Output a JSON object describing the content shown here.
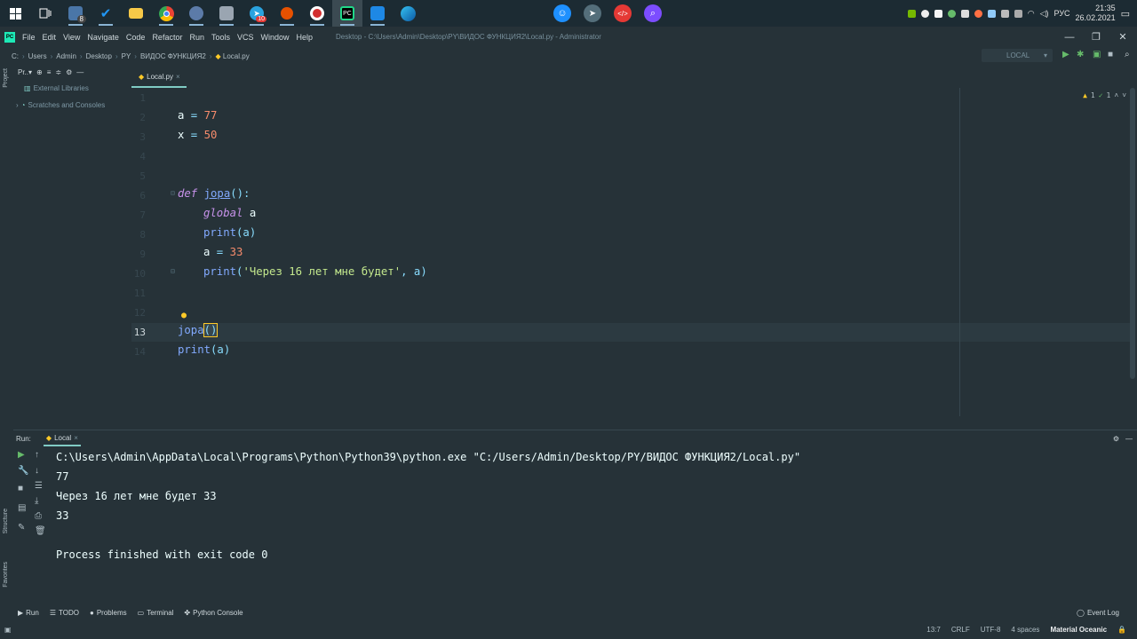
{
  "taskbar": {
    "badge_1": "8",
    "badge_2": "10",
    "clock_time": "21:35",
    "clock_date": "26.02.2021",
    "lang": "РУС"
  },
  "menubar": {
    "logo": "PC",
    "items": [
      "File",
      "Edit",
      "View",
      "Navigate",
      "Code",
      "Refactor",
      "Run",
      "Tools",
      "VCS",
      "Window",
      "Help"
    ],
    "window_title": "Desktop - C:\\Users\\Admin\\Desktop\\PY\\ВИДОС ФУНКЦИЯ2\\Local.py - Administrator"
  },
  "breadcrumb": [
    "C:",
    "Users",
    "Admin",
    "Desktop",
    "PY",
    "ВИДОС ФУНКЦИЯ2",
    "Local.py"
  ],
  "run_config": {
    "name": "LOCAL"
  },
  "project_panel": {
    "title": "Pr..▾",
    "items": [
      "External Libraries",
      "Scratches and Consoles"
    ],
    "stripe_label": "Project"
  },
  "editor": {
    "tab": "Local.py",
    "inspection": {
      "warnings": "1",
      "ok": "1"
    },
    "line_numbers": [
      "1",
      "2",
      "3",
      "4",
      "5",
      "6",
      "7",
      "8",
      "9",
      "10",
      "11",
      "12",
      "13",
      "14"
    ],
    "lines": {
      "l2_var": "a",
      "l2_op": " = ",
      "l2_num": "77",
      "l3_var": "x",
      "l3_op": " = ",
      "l3_num": "50",
      "l6_kw": "def",
      "l6_fn": "jopa",
      "l6_rest": "():",
      "l7_kw": "global",
      "l7_var": " a",
      "l8_fn": "print",
      "l8_rest": "(a)",
      "l9_var": "a",
      "l9_op": " = ",
      "l9_num": "33",
      "l10_fn": "print",
      "l10_p1": "(",
      "l10_str": "'Через 16 лет мне будет'",
      "l10_rest": ", a)",
      "l13_fn": "jopa",
      "l13_rest": "()",
      "l14_fn": "print",
      "l14_rest": "(a)"
    }
  },
  "run_panel": {
    "label": "Run:",
    "tab": "Local",
    "output": [
      "C:\\Users\\Admin\\AppData\\Local\\Programs\\Python\\Python39\\python.exe \"C:/Users/Admin/Desktop/PY/ВИДОС ФУНКЦИЯ2/Local.py\"",
      "77",
      "Через 16 лет мне будет 33",
      "33",
      "",
      "Process finished with exit code 0"
    ],
    "stripe_structure": "Structure",
    "stripe_favorites": "Favorites"
  },
  "bottom_tools": {
    "run": "Run",
    "todo": "TODO",
    "problems": "Problems",
    "terminal": "Terminal",
    "python_console": "Python Console",
    "event_log": "Event Log"
  },
  "statusbar": {
    "position": "13:7",
    "line_sep": "CRLF",
    "encoding": "UTF-8",
    "indent": "4 spaces",
    "theme": "Material Oceanic"
  }
}
